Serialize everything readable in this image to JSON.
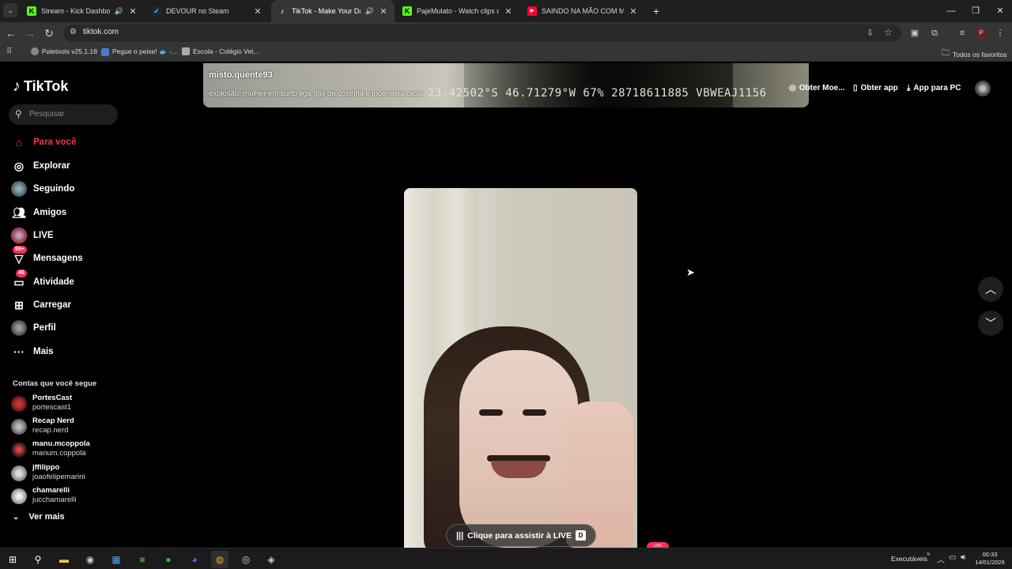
{
  "browser": {
    "tabs": [
      {
        "title": "Stream - Kick Dashboard",
        "favicon": "kick-favicon",
        "color": "#53fc18",
        "audio": true
      },
      {
        "title": "DEVOUR no Steam",
        "favicon": "steam-favicon",
        "color": "#66c0f4",
        "audio": false
      },
      {
        "title": "TikTok - Make Your Day",
        "favicon": "tiktok-favicon",
        "color": "#ffffff",
        "audio": true,
        "active": true
      },
      {
        "title": "PajeMulato - Watch clips on Kick",
        "favicon": "kick-favicon",
        "color": "#53fc18",
        "audio": false
      },
      {
        "title": "SAINDO NA MÃO COM MEUS",
        "favicon": "youtube-favicon",
        "color": "#ff0033",
        "audio": false
      }
    ],
    "url": "tiktok.com",
    "profile_initial": "P",
    "bookmarks": [
      {
        "label": "Paletools v25.1.18",
        "color": "#888888"
      },
      {
        "label": "Pegue o peixe! 🐟 -...",
        "color": "#4a7bd0"
      },
      {
        "label": "Escola - Colégio Vet...",
        "color": "#aaaaaa"
      }
    ],
    "all_bookmarks": "Todos os favoritos"
  },
  "tiktok": {
    "logo": "TikTok",
    "search_placeholder": "Pesquisar",
    "nav": [
      {
        "label": "Para você",
        "icon": "home-icon",
        "active": true
      },
      {
        "label": "Explorar",
        "icon": "compass-icon"
      },
      {
        "label": "Seguindo",
        "icon": "following-avatar-icon"
      },
      {
        "label": "Amigos",
        "icon": "friends-icon"
      },
      {
        "label": "LIVE",
        "icon": "live-icon"
      },
      {
        "label": "Mensagens",
        "icon": "messages-icon",
        "badge": "99+"
      },
      {
        "label": "Atividade",
        "icon": "activity-icon",
        "badge": "46"
      },
      {
        "label": "Carregar",
        "icon": "upload-icon"
      },
      {
        "label": "Perfil",
        "icon": "profile-icon"
      },
      {
        "label": "Mais",
        "icon": "more-icon"
      }
    ],
    "follows_title": "Contas que você segue",
    "accounts": [
      {
        "name": "PortesCast",
        "handle": "portescast1",
        "color": "#7a1f1f"
      },
      {
        "name": "Recap Nerd",
        "handle": "recap.nerd",
        "color": "#777777"
      },
      {
        "name": "manu.mcoppola",
        "handle": "manum.coppola",
        "color": "#a02020"
      },
      {
        "name": "jffilippo",
        "handle": "joaofelipemarini",
        "color": "#999999"
      },
      {
        "name": "chamarelli",
        "handle": "jucchamarelli",
        "color": "#b0b0b0"
      }
    ],
    "see_more": "Ver mais",
    "top_video": {
      "username": "misto.quente93",
      "caption": "explosão: mulher em surto liga gás de cozinha e incendeia casa",
      "overlay_text": "23.42502°S 46.71279°W 67% 28718611885 VBWEAJ1156"
    },
    "top_actions": [
      {
        "label": "Obter Moe...",
        "icon": "coin-icon"
      },
      {
        "label": "Obter app",
        "icon": "phone-icon"
      },
      {
        "label": "App para PC",
        "icon": "download-icon"
      }
    ],
    "live": {
      "watch_label": "Clique para assistir à LIVE",
      "watch_key": "D",
      "badge": "LIVE"
    }
  },
  "taskbar": {
    "apps": [
      "start-icon",
      "search-icon",
      "file-explorer-icon",
      "steam-icon",
      "app-icon",
      "minecraft-icon",
      "spotify-icon",
      "discord-icon",
      "chrome-icon",
      "obs-icon",
      "game-icon"
    ],
    "tray_label": "Executáveis",
    "time": "00:33",
    "date": "14/01/2026"
  }
}
